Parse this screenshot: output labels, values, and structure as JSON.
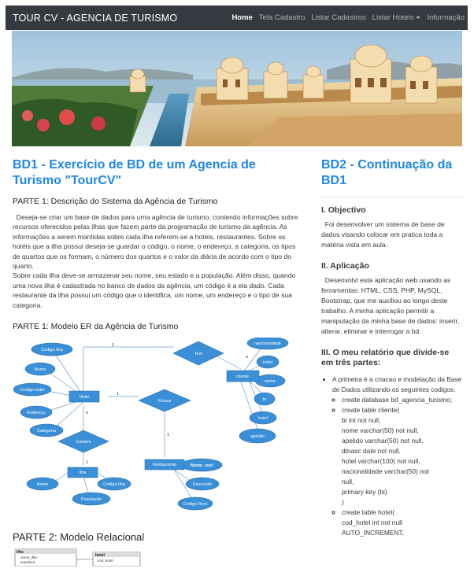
{
  "navbar": {
    "brand": "TOUR CV - AGENCIA DE TURISMO",
    "items": [
      {
        "label": "Home",
        "active": true
      },
      {
        "label": "Tela Cadastro"
      },
      {
        "label": "Listar Cadastros"
      },
      {
        "label": "Listar Hoteis"
      },
      {
        "label": "Informação"
      }
    ]
  },
  "colors": {
    "accent": "#1e88e5",
    "navbar": "#343a40",
    "diagram_blue": "#3a8fd6"
  },
  "left": {
    "title": "BD1 - Exercício de BD de um Agencia de Turismo \"TourCV\"",
    "part1_heading": "PARTE 1: Descrição do Sistema da Agência de Turismo",
    "part1_p1": "Deseja-se criar um base de dados para uma agência de turismo, contendo informações sobre recursos oferecidos pelas ilhas que fazem parte da programação de turismo da agência. As informações a serem mantidas sobre cada ilha referem-se a hotéis, restaurantes. Sobre os hotéis que a ilha possui deseja-se guardar o código, o nome, o endereço, a categoria, os tipos de quartos que os formam, o número dos quartos e o valor da diária de acordo com o tipo do quarto.",
    "part1_p2": "Sobre cada ilha deve-se armazenar seu nome, seu estado e a população. Além disso, quando uma nova ilha é cadastrada no banco de dados da agência, um código é a ela dado. Cada restaurante da ilha possui um código que o identifica, um nome, um endereço e o tipo de sua categoria.",
    "er_heading": "PARTE 1: Modelo ER da Agência de Turismo",
    "part2_heading": "PARTE 2: Modelo Relacional"
  },
  "er": {
    "entities": {
      "hotel": "Hotel",
      "cliente": "cliente",
      "ilha": "Ilha",
      "restaurante": "Restaurante"
    },
    "relations": {
      "tem": "Tem",
      "possui": "Possui",
      "contem": "Contem"
    },
    "hotel_attrs": [
      "Codigo Ilha",
      "Nome",
      "Codigo hotel",
      "Endereço",
      "Categoria"
    ],
    "cliente_attrs": [
      "nacionalidade",
      "hotel",
      "nome",
      "bi",
      "hotel",
      "apelido"
    ],
    "ilha_attrs": [
      "Nome",
      "Codigo Ilha",
      "População"
    ],
    "rest_attrs": [
      "Nome_rest",
      "Descrição",
      "Codigo Rest"
    ],
    "cardinalities": [
      "1",
      "n",
      "1",
      "n",
      "1",
      "1"
    ]
  },
  "relational": {
    "ilha_title": "ilha",
    "ilha_fields": [
      "nome_ilha",
      "populaca"
    ],
    "hotel_title": "hotel",
    "hotel_fields": [
      "cod_hotel"
    ]
  },
  "right": {
    "title": "BD2 - Continuação da BD1",
    "s1_heading": "I. Objectivo",
    "s1_text": "Foi desenvolver um sistema de base de dados visando colocar em pratica toda a matéria vista em aula.",
    "s2_heading": "II. Aplicação",
    "s2_text": "Desenvolvi esta aplicação web usando as ferramentas: HTML, CSS, PHP, MySQL, Bootstrap, que me auxiliou ao longo deste trabalho. A minha aplicação permitir a manipulação da minha base de dados: inserir, alterar, eliminar e interrogar a bd.",
    "s3_heading": "III. O meu relatório que divide-se em três partes:",
    "bullet1": "A primeira é a criacao e modelação da Base de Dados utilizando os seguintes codigos:",
    "code1": "create database bd_agencia_turismo;",
    "code2_lines": [
      "create table cliente(",
      "bi int not null,",
      "nome varchar(50) not null,",
      "apelido varchar(50) not null,",
      "dtnasc date not null,",
      "hotel varchar(100) not null,",
      "nacionalidade varchar(50) not",
      "null,",
      "primary key (bi)",
      ")"
    ],
    "code3_lines": [
      "create table hotel(",
      "cod_hotel int not null",
      "AUTO_INCREMENT,"
    ]
  }
}
